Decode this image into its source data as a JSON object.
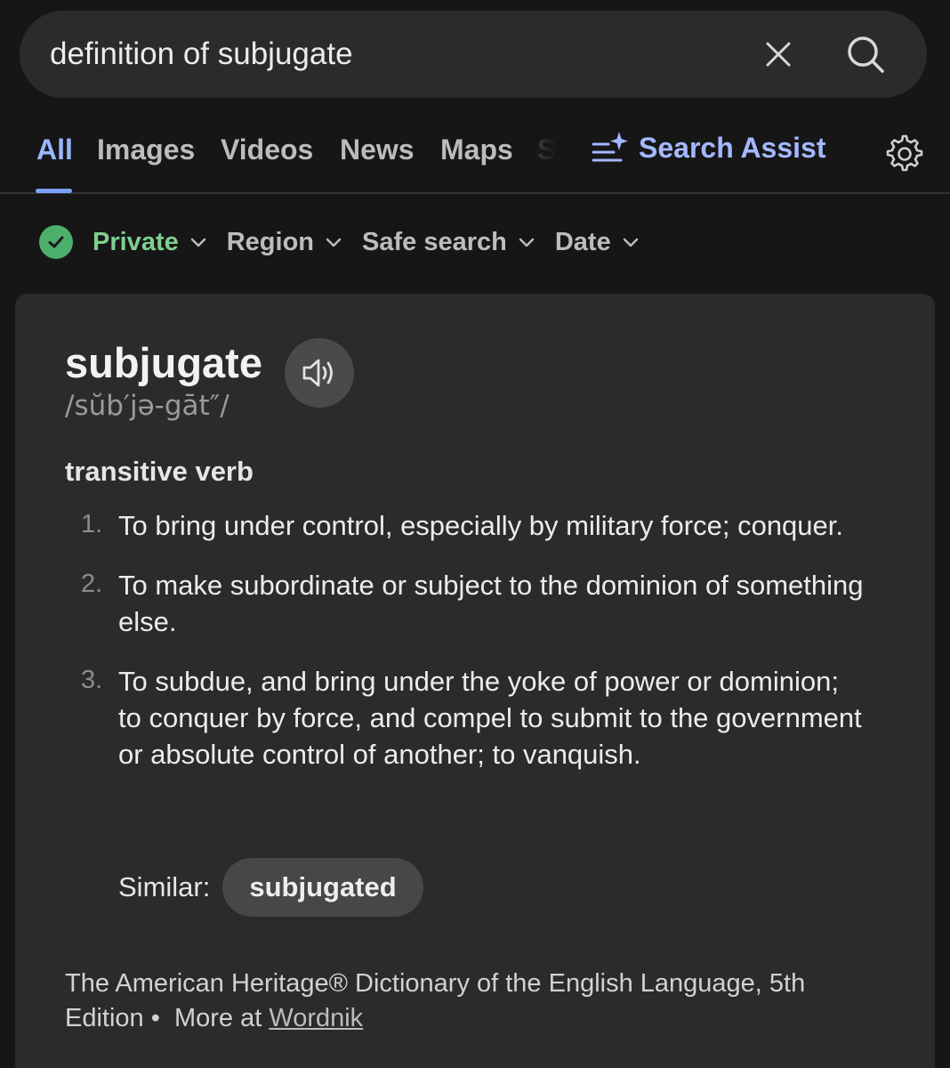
{
  "search": {
    "query": "definition of subjugate"
  },
  "tabs": [
    {
      "label": "All",
      "active": true
    },
    {
      "label": "Images"
    },
    {
      "label": "Videos"
    },
    {
      "label": "News"
    },
    {
      "label": "Maps"
    },
    {
      "label": "S"
    }
  ],
  "assist": {
    "label": "Search Assist"
  },
  "filters": {
    "private": "Private",
    "region": "Region",
    "safe_search": "Safe search",
    "date": "Date"
  },
  "definition": {
    "word": "subjugate",
    "phonetic": "/sŭb′jə-gāt″/",
    "part_of_speech": "transitive verb",
    "senses": [
      {
        "num": "1.",
        "text": "To bring under control, especially by military force; conquer."
      },
      {
        "num": "2.",
        "text": "To make subordinate or subject to the dominion of something else."
      },
      {
        "num": "3.",
        "text": "To subdue, and bring under the yoke of power or dominion; to conquer by force, and compel to submit to the government or absolute control of another; to vanquish."
      }
    ],
    "similar_label": "Similar:",
    "similar_word": "subjugated",
    "source_text": "The American Heritage® Dictionary of the English Language, 5th Edition •",
    "more_text": "More at",
    "more_link": "Wordnik"
  },
  "colors": {
    "background": "#161616",
    "card": "#2b2b2b",
    "accent": "#9bb4ff",
    "private_green": "#4caf6b"
  },
  "icons": [
    "close-icon",
    "search-icon",
    "sparkle-list-icon",
    "gear-icon",
    "check-icon",
    "chevron-down-icon",
    "speaker-icon"
  ]
}
